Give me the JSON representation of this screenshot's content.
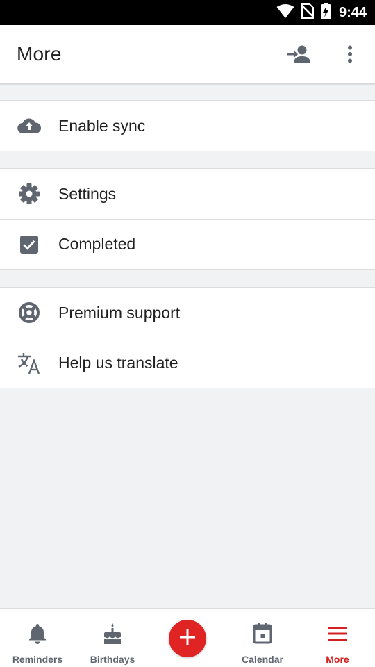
{
  "status_bar": {
    "time": "9:44"
  },
  "app_bar": {
    "title": "More"
  },
  "menu": {
    "group1": [
      {
        "label": "Enable sync",
        "icon": "cloud-upload-icon"
      }
    ],
    "group2": [
      {
        "label": "Settings",
        "icon": "gear-icon"
      },
      {
        "label": "Completed",
        "icon": "checkbox-icon"
      }
    ],
    "group3": [
      {
        "label": "Premium support",
        "icon": "lifebuoy-icon"
      },
      {
        "label": "Help us translate",
        "icon": "translate-icon"
      }
    ]
  },
  "bottom_nav": {
    "items": [
      {
        "label": "Reminders",
        "icon": "bell-icon"
      },
      {
        "label": "Birthdays",
        "icon": "cake-icon"
      },
      {
        "label": "Calendar",
        "icon": "calendar-icon"
      },
      {
        "label": "More",
        "icon": "menu-icon",
        "active": true
      }
    ]
  },
  "colors": {
    "accent": "#e02424",
    "active_nav": "#d32020",
    "icon": "#5f6670",
    "background": "#f1f2f4"
  }
}
